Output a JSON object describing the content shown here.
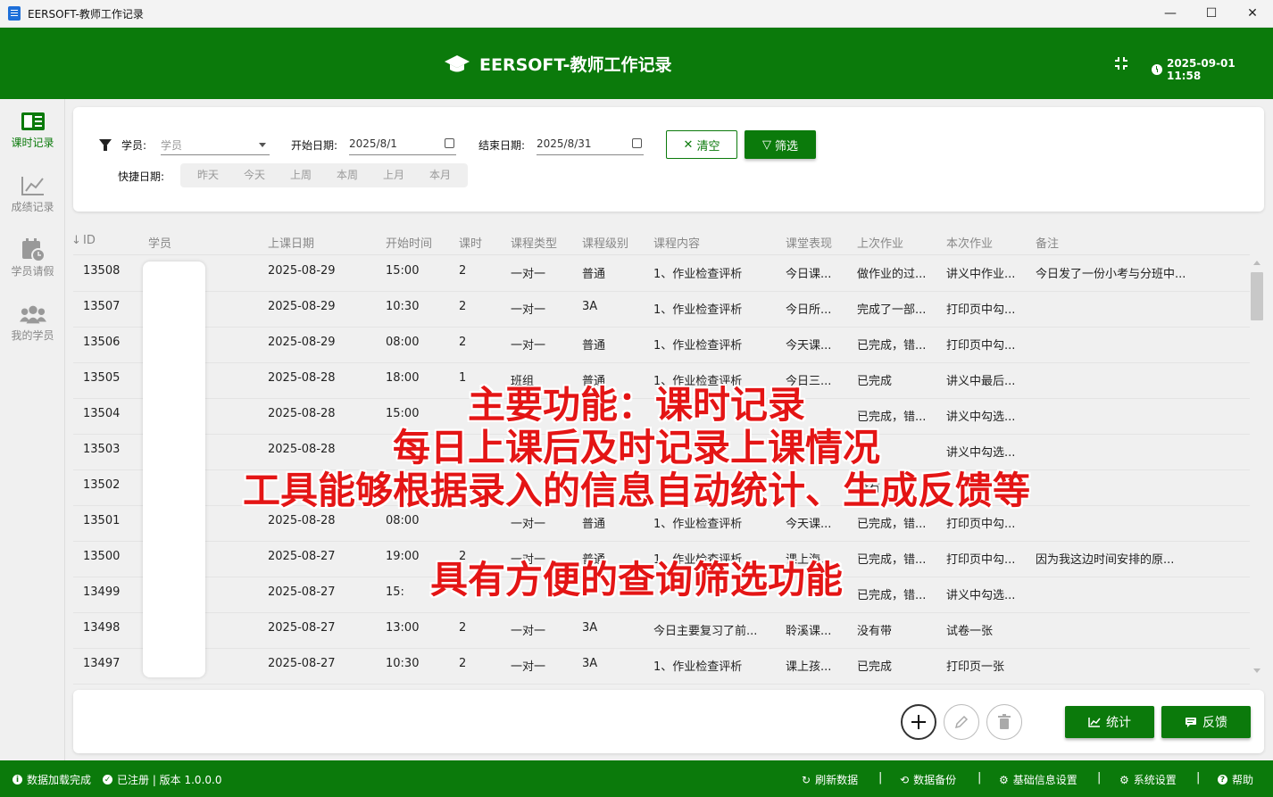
{
  "window": {
    "title": "EERSOFT-教师工作记录",
    "controls": {
      "minimize": "—",
      "maximize": "☐",
      "close": "✕"
    }
  },
  "header": {
    "icon": "graduation-cap-icon",
    "title": "EERSOFT-教师工作记录",
    "datetime": "2025-09-01 11:58"
  },
  "sidebar": {
    "items": [
      {
        "label": "课时记录",
        "icon": "notebook-icon",
        "active": true
      },
      {
        "label": "成绩记录",
        "icon": "line-chart-icon",
        "active": false
      },
      {
        "label": "学员请假",
        "icon": "calendar-clock-icon",
        "active": false
      },
      {
        "label": "我的学员",
        "icon": "people-icon",
        "active": false
      }
    ]
  },
  "filter": {
    "student_label": "学员:",
    "student_placeholder": "学员",
    "start_label": "开始日期:",
    "start_value": "2025/8/1",
    "end_label": "结束日期:",
    "end_value": "2025/8/31",
    "clear_label": "清空",
    "filter_label": "筛选",
    "quick_label": "快捷日期:",
    "quick": [
      "昨天",
      "今天",
      "上周",
      "本周",
      "上月",
      "本月"
    ]
  },
  "table": {
    "headers": [
      "ID",
      "学员",
      "上课日期",
      "开始时间",
      "课时",
      "课程类型",
      "课程级别",
      "课程内容",
      "课堂表现",
      "上次作业",
      "本次作业",
      "备注"
    ],
    "rows": [
      [
        "13508",
        "",
        "2025-08-29",
        "15:00",
        "2",
        "一对一",
        "普通",
        "1、作业检查评析",
        "今日课...",
        "做作业的过...",
        "讲义中作业...",
        "今日发了一份小考与分班中..."
      ],
      [
        "13507",
        "",
        "2025-08-29",
        "10:30",
        "2",
        "一对一",
        "3A",
        "1、作业检查评析",
        "今日所...",
        "完成了一部...",
        "打印页中勾...",
        ""
      ],
      [
        "13506",
        "",
        "2025-08-29",
        "08:00",
        "2",
        "一对一",
        "普通",
        "1、作业检查评析",
        "今天课...",
        "已完成，错...",
        "打印页中勾...",
        ""
      ],
      [
        "13505",
        "",
        "2025-08-28",
        "18:00",
        "1",
        "班组",
        "普通",
        "1、作业检查评析",
        "今日三...",
        "已完成",
        "讲义中最后...",
        ""
      ],
      [
        "13504",
        "",
        "2025-08-28",
        "15:00",
        "",
        "",
        "",
        "",
        "",
        "已完成，错...",
        "讲义中勾选...",
        ""
      ],
      [
        "13503",
        "",
        "2025-08-28",
        "",
        "",
        "",
        "",
        "",
        "",
        "",
        "讲义中勾选...",
        ""
      ],
      [
        "13502",
        "",
        "",
        "",
        "",
        "",
        "",
        "",
        "",
        "没有",
        "",
        ""
      ],
      [
        "13501",
        "",
        "2025-08-28",
        "08:00",
        "",
        "一对一",
        "普通",
        "1、作业检查评析",
        "今天课...",
        "已完成，错...",
        "打印页中勾...",
        ""
      ],
      [
        "13500",
        "",
        "2025-08-27",
        "19:00",
        "2",
        "一对一",
        "普通",
        "1、作业检查评析",
        "课上海...",
        "已完成，错...",
        "打印页中勾...",
        "因为我这边时间安排的原..."
      ],
      [
        "13499",
        "",
        "2025-08-27",
        "15:",
        "",
        "",
        "",
        "",
        "",
        "已完成，错...",
        "讲义中勾选...",
        ""
      ],
      [
        "13498",
        "",
        "2025-08-27",
        "13:00",
        "2",
        "一对一",
        "3A",
        "今日主要复习了前...",
        "聆溪课...",
        "没有带",
        "试卷一张",
        ""
      ],
      [
        "13497",
        "",
        "2025-08-27",
        "10:30",
        "2",
        "一对一",
        "3A",
        "1、作业检查评析",
        "课上孩...",
        "已完成",
        "打印页一张",
        ""
      ]
    ]
  },
  "actions": {
    "stats_label": "统计",
    "feedback_label": "反馈"
  },
  "statusbar": {
    "load_status": "数据加载完成",
    "reg_status": "已注册 | 版本 1.0.0.0",
    "refresh": "刷新数据",
    "backup": "数据备份",
    "basic_settings": "基础信息设置",
    "system_settings": "系统设置",
    "help": "帮助",
    "separator": "|"
  },
  "overlay": {
    "line1": "主要功能：课时记录",
    "line2": "每日上课后及时记录上课情况",
    "line3": "工具能够根据录入的信息自动统计、生成反馈等",
    "line4": "具有方便的查询筛选功能"
  },
  "colors": {
    "brand": "#0b7a0b",
    "annotation": "#e41515"
  }
}
